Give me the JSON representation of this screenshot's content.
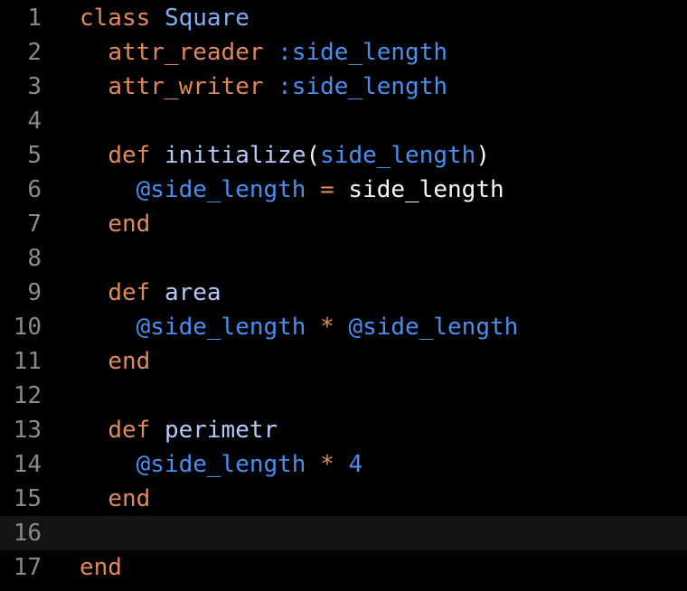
{
  "editor": {
    "language": "ruby",
    "current_line": 16,
    "colors": {
      "background": "#000000",
      "line_number": "#8a8a8a",
      "keyword": "#e0885e",
      "class_name": "#82aef8",
      "method_name": "#b6c9f8",
      "symbol": "#4a8ff0",
      "instance_variable": "#4a8ff0",
      "operator": "#e0885e",
      "number": "#4a8ff0",
      "plain": "#f8f8f2",
      "current_line_highlight": "#141414"
    },
    "lines": [
      {
        "n": "1",
        "tokens": [
          {
            "t": "class",
            "k": "kw"
          },
          {
            "t": " ",
            "k": "plain"
          },
          {
            "t": "Square",
            "k": "cls"
          }
        ]
      },
      {
        "n": "2",
        "tokens": [
          {
            "t": "  ",
            "k": "plain"
          },
          {
            "t": "attr_reader",
            "k": "kw"
          },
          {
            "t": " ",
            "k": "plain"
          },
          {
            "t": ":side_length",
            "k": "sym"
          }
        ]
      },
      {
        "n": "3",
        "tokens": [
          {
            "t": "  ",
            "k": "plain"
          },
          {
            "t": "attr_writer",
            "k": "kw"
          },
          {
            "t": " ",
            "k": "plain"
          },
          {
            "t": ":side_length",
            "k": "sym"
          }
        ]
      },
      {
        "n": "4",
        "tokens": []
      },
      {
        "n": "5",
        "tokens": [
          {
            "t": "  ",
            "k": "plain"
          },
          {
            "t": "def",
            "k": "kw"
          },
          {
            "t": " ",
            "k": "plain"
          },
          {
            "t": "initialize",
            "k": "fn"
          },
          {
            "t": "(",
            "k": "punc"
          },
          {
            "t": "side_length",
            "k": "sym"
          },
          {
            "t": ")",
            "k": "punc"
          }
        ]
      },
      {
        "n": "6",
        "tokens": [
          {
            "t": "    ",
            "k": "plain"
          },
          {
            "t": "@side_length",
            "k": "ivar"
          },
          {
            "t": " ",
            "k": "plain"
          },
          {
            "t": "=",
            "k": "op"
          },
          {
            "t": " side_length",
            "k": "plain"
          }
        ]
      },
      {
        "n": "7",
        "tokens": [
          {
            "t": "  ",
            "k": "plain"
          },
          {
            "t": "end",
            "k": "kw"
          }
        ]
      },
      {
        "n": "8",
        "tokens": []
      },
      {
        "n": "9",
        "tokens": [
          {
            "t": "  ",
            "k": "plain"
          },
          {
            "t": "def",
            "k": "kw"
          },
          {
            "t": " ",
            "k": "plain"
          },
          {
            "t": "area",
            "k": "fn"
          }
        ]
      },
      {
        "n": "10",
        "tokens": [
          {
            "t": "    ",
            "k": "plain"
          },
          {
            "t": "@side_length",
            "k": "ivar"
          },
          {
            "t": " ",
            "k": "plain"
          },
          {
            "t": "*",
            "k": "op"
          },
          {
            "t": " ",
            "k": "plain"
          },
          {
            "t": "@side_length",
            "k": "ivar"
          }
        ]
      },
      {
        "n": "11",
        "tokens": [
          {
            "t": "  ",
            "k": "plain"
          },
          {
            "t": "end",
            "k": "kw"
          }
        ]
      },
      {
        "n": "12",
        "tokens": []
      },
      {
        "n": "13",
        "tokens": [
          {
            "t": "  ",
            "k": "plain"
          },
          {
            "t": "def",
            "k": "kw"
          },
          {
            "t": " ",
            "k": "plain"
          },
          {
            "t": "perimetr",
            "k": "fn"
          }
        ]
      },
      {
        "n": "14",
        "tokens": [
          {
            "t": "    ",
            "k": "plain"
          },
          {
            "t": "@side_length",
            "k": "ivar"
          },
          {
            "t": " ",
            "k": "plain"
          },
          {
            "t": "*",
            "k": "op"
          },
          {
            "t": " ",
            "k": "plain"
          },
          {
            "t": "4",
            "k": "num"
          }
        ]
      },
      {
        "n": "15",
        "tokens": [
          {
            "t": "  ",
            "k": "plain"
          },
          {
            "t": "end",
            "k": "kw"
          }
        ]
      },
      {
        "n": "16",
        "tokens": []
      },
      {
        "n": "17",
        "tokens": [
          {
            "t": "end",
            "k": "kw"
          }
        ]
      }
    ]
  }
}
